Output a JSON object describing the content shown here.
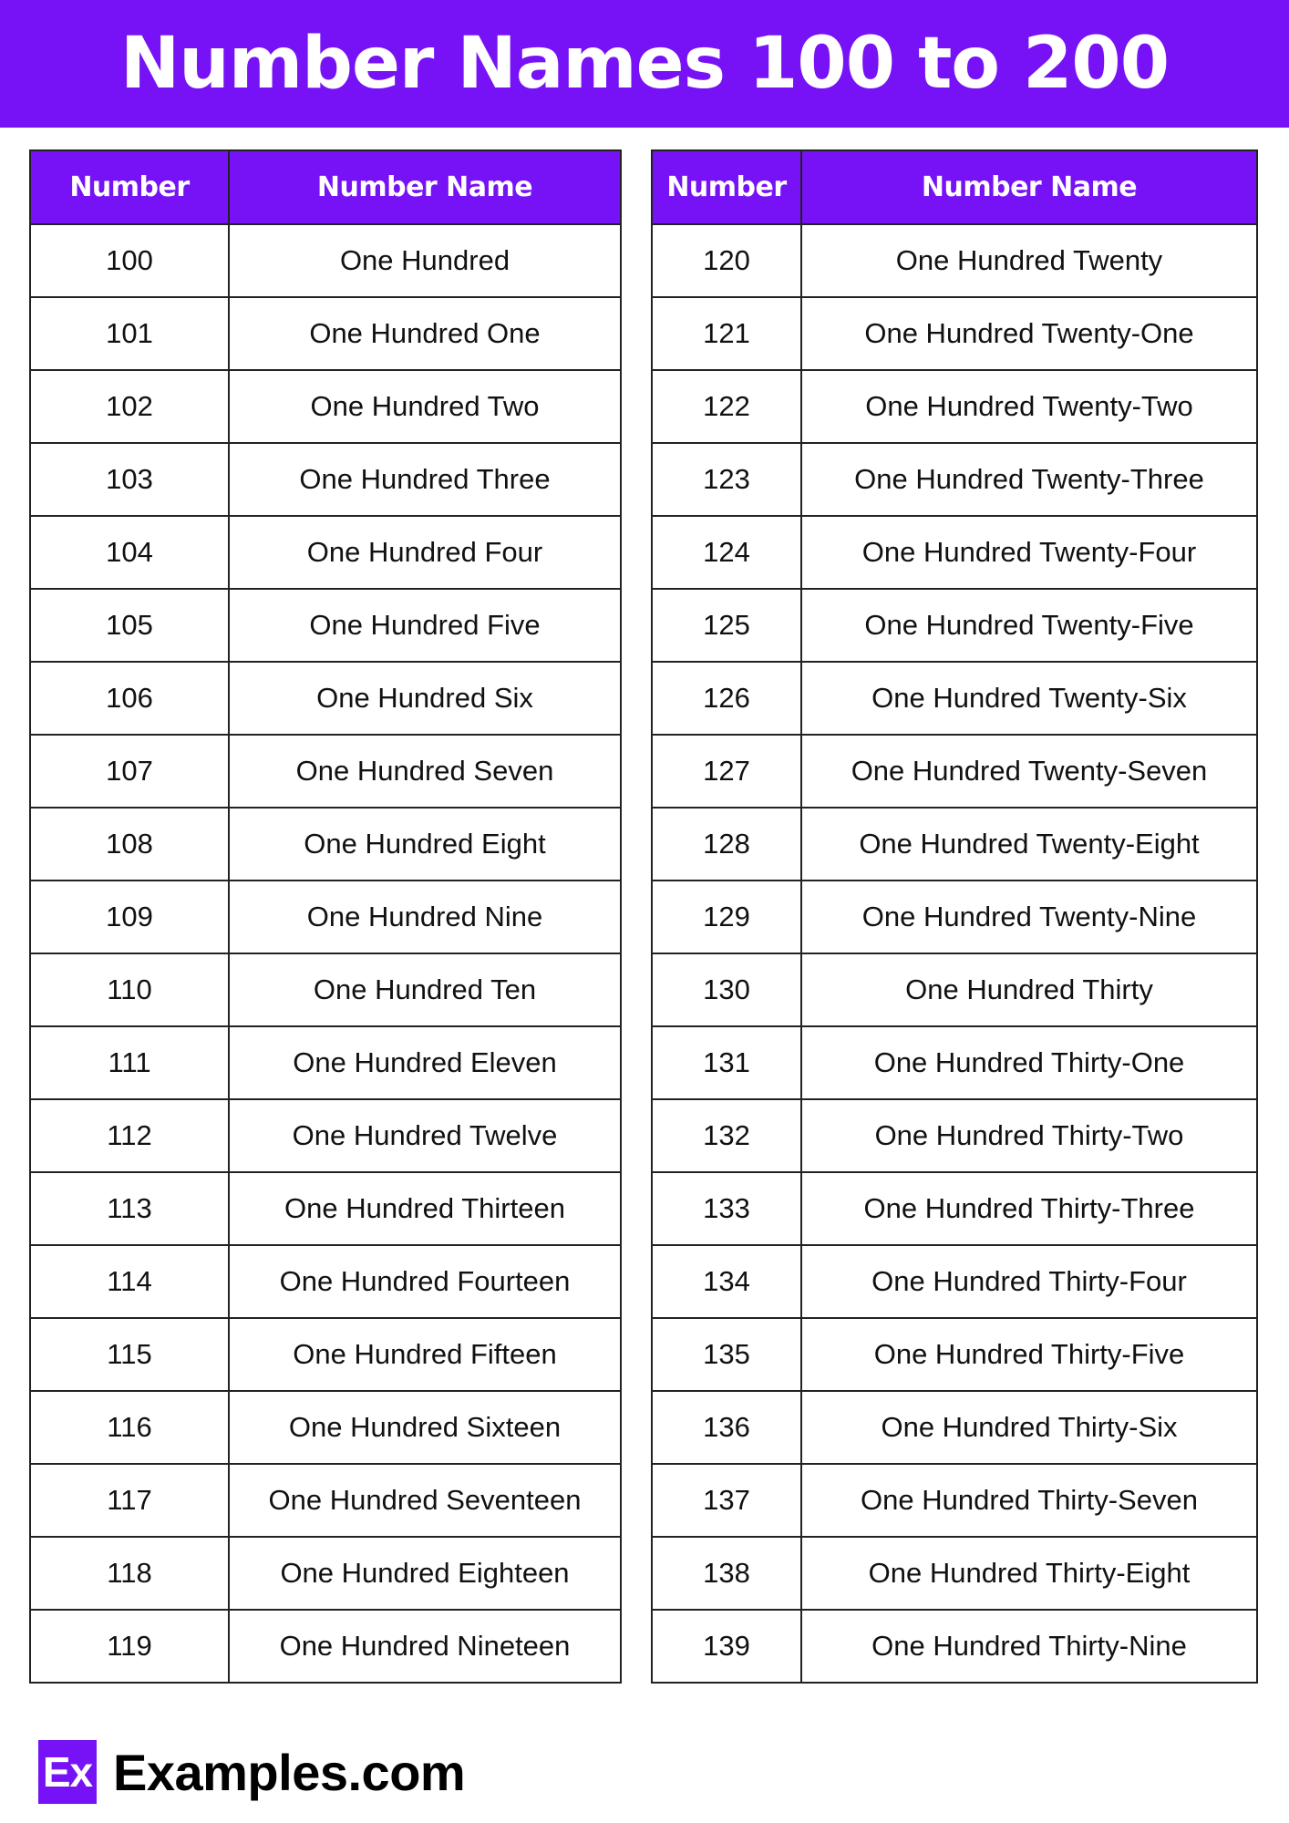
{
  "title": "Number Names 100 to 200",
  "colors": {
    "accent": "#7612f5",
    "text": "#111111",
    "background": "#ffffff"
  },
  "tables": [
    {
      "headers": [
        "Number",
        "Number Name"
      ],
      "rows": [
        [
          "100",
          "One Hundred"
        ],
        [
          "101",
          "One Hundred One"
        ],
        [
          "102",
          "One Hundred Two"
        ],
        [
          "103",
          "One Hundred Three"
        ],
        [
          "104",
          "One Hundred Four"
        ],
        [
          "105",
          "One Hundred Five"
        ],
        [
          "106",
          "One Hundred Six"
        ],
        [
          "107",
          "One Hundred Seven"
        ],
        [
          "108",
          "One Hundred Eight"
        ],
        [
          "109",
          "One Hundred Nine"
        ],
        [
          "110",
          "One Hundred Ten"
        ],
        [
          "111",
          "One Hundred Eleven"
        ],
        [
          "112",
          "One Hundred Twelve"
        ],
        [
          "113",
          "One Hundred Thirteen"
        ],
        [
          "114",
          "One Hundred Fourteen"
        ],
        [
          "115",
          "One Hundred Fifteen"
        ],
        [
          "116",
          "One Hundred Sixteen"
        ],
        [
          "117",
          "One Hundred Seventeen"
        ],
        [
          "118",
          "One Hundred Eighteen"
        ],
        [
          "119",
          "One Hundred Nineteen"
        ]
      ]
    },
    {
      "headers": [
        "Number",
        "Number Name"
      ],
      "rows": [
        [
          "120",
          "One Hundred Twenty"
        ],
        [
          "121",
          "One Hundred Twenty-One"
        ],
        [
          "122",
          "One Hundred Twenty-Two"
        ],
        [
          "123",
          "One Hundred Twenty-Three"
        ],
        [
          "124",
          "One Hundred Twenty-Four"
        ],
        [
          "125",
          "One Hundred Twenty-Five"
        ],
        [
          "126",
          "One Hundred Twenty-Six"
        ],
        [
          "127",
          "One Hundred Twenty-Seven"
        ],
        [
          "128",
          "One Hundred Twenty-Eight"
        ],
        [
          "129",
          "One Hundred Twenty-Nine"
        ],
        [
          "130",
          "One Hundred Thirty"
        ],
        [
          "131",
          "One Hundred Thirty-One"
        ],
        [
          "132",
          "One Hundred Thirty-Two"
        ],
        [
          "133",
          "One Hundred Thirty-Three"
        ],
        [
          "134",
          "One Hundred Thirty-Four"
        ],
        [
          "135",
          "One Hundred Thirty-Five"
        ],
        [
          "136",
          "One Hundred Thirty-Six"
        ],
        [
          "137",
          "One Hundred Thirty-Seven"
        ],
        [
          "138",
          "One Hundred Thirty-Eight"
        ],
        [
          "139",
          "One Hundred Thirty-Nine"
        ]
      ]
    }
  ],
  "footer": {
    "logo_mark": "Ex",
    "logo_text": "Examples.com",
    "logo_icon": "examples-logo-icon"
  }
}
